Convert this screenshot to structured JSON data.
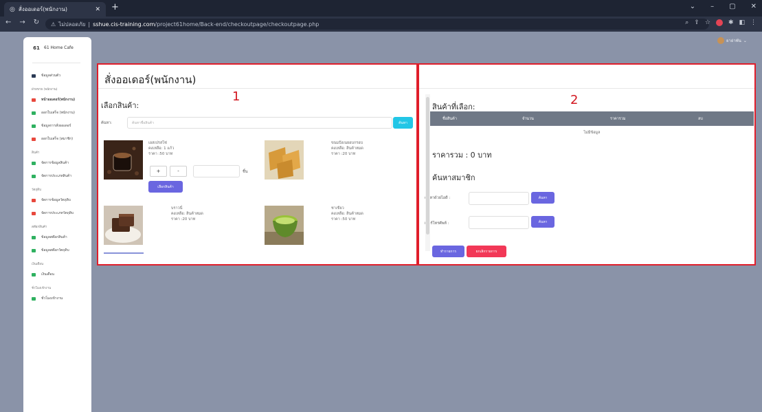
{
  "browser": {
    "tab_title": "สั่งออเดอร์(พนักงาน)",
    "new_tab": "+",
    "security_label": "ไม่ปลอดภัย",
    "url_domain": "sshue.cis-training.com",
    "url_path": "/project61home/Back-end/checkoutpage/checkoutpage.php"
  },
  "sidebar": {
    "brand_logo": "61",
    "brand_name": "61 Home Cafe",
    "items": [
      {
        "type": "item",
        "label": "ข้อมูลส่วนตัว",
        "color": "#2b3a55"
      },
      {
        "type": "head",
        "label": "ฝ่ายขาย (พนักงาน)"
      },
      {
        "type": "item",
        "label": "หน้าออเดอร์(พนักงาน)",
        "color": "#e8483d",
        "bold": true
      },
      {
        "type": "item",
        "label": "ออกใบเสร็จ (พนักงาน)",
        "color": "#2fb160"
      },
      {
        "type": "item",
        "label": "ข้อมูลการสั่งออเดอร์",
        "color": "#2fb160"
      },
      {
        "type": "item",
        "label": "ออกใบเสร็จ (สมาชิก)",
        "color": "#e8483d"
      },
      {
        "type": "head",
        "label": "สินค้า"
      },
      {
        "type": "item",
        "label": "จัดการข้อมูลสินค้า",
        "color": "#2fb160"
      },
      {
        "type": "item",
        "label": "จัดการประเภทสินค้า",
        "color": "#2fb160"
      },
      {
        "type": "head",
        "label": "วัตถุดิบ"
      },
      {
        "type": "item",
        "label": "จัดการข้อมูลวัตถุดิบ",
        "color": "#e8483d"
      },
      {
        "type": "item",
        "label": "จัดการประเภทวัตถุดิบ",
        "color": "#e8483d"
      },
      {
        "type": "head",
        "label": "สต๊อกสินค้า"
      },
      {
        "type": "item",
        "label": "ข้อมูลสต๊อกสินค้า",
        "color": "#2fb160"
      },
      {
        "type": "item",
        "label": "ข้อมูลสต๊อกวัตถุดิบ",
        "color": "#2fb160"
      },
      {
        "type": "head",
        "label": "เงินเดือน"
      },
      {
        "type": "item",
        "label": "เงินเดือน",
        "color": "#2fb160"
      },
      {
        "type": "head",
        "label": "ชั่วโมงเข้างาน"
      },
      {
        "type": "item",
        "label": "ชั่วโมงเข้างาน",
        "color": "#2fb160"
      }
    ]
  },
  "topbar": {
    "user": "ยาย่าพัน"
  },
  "panel1": {
    "annotation": "1",
    "title": "สั่งออเดอร์(พนักงาน)",
    "section": "เลือกสินค้า:",
    "search_label": "ค้นหา:",
    "search_placeholder": "ค้นหาชื่อสินค้า",
    "search_button": "ค้นหา",
    "products": [
      {
        "name": "เอสเปรสโซ่",
        "stock": "คงเหลือ: 1 แก้ว",
        "price": "ราคา :50 บาท",
        "img": "coffee"
      },
      {
        "name": "ขนมปังเนยอบกรอบ",
        "stock": "คงเหลือ: สินค้าหมด",
        "price": "ราคา :20 บาท",
        "img": "toast"
      },
      {
        "name": "บราวนี่",
        "stock": "คงเหลือ: สินค้าหมด",
        "price": "ราคา :20 บาท",
        "img": "brownie"
      },
      {
        "name": "ชาเขียว",
        "stock": "คงเหลือ: สินค้าหมด",
        "price": "ราคา :50 บาท",
        "img": "greentea"
      }
    ],
    "plus": "+",
    "minus": "-",
    "unit": "ชิ้น",
    "select_button": "เลือกสินค้า"
  },
  "panel2": {
    "annotation": "2",
    "section": "สินค้าที่เลือก:",
    "table_headers": [
      "ชื่อสินค้า",
      "จำนวน",
      "ราคารวม",
      "ลบ"
    ],
    "no_data": "ไม่มีข้อมูล",
    "total": "ราคารวม : 0 บาท",
    "member_section": "ค้นหาสมาชิก",
    "search_id_label": "ค้นหาด้วยไอดี :",
    "search_phone_label": "เบอร์โทรศัพท์ :",
    "search_button": "ค้นหา",
    "submit_button": "ทำรายการ",
    "cancel_button": "ยกเลิกรายการ"
  },
  "colors": {
    "highlight": "#e01d2a",
    "cyan": "#22c6e6",
    "purple": "#6a66e0",
    "danger": "#f23857",
    "page_bg": "#8a93a8"
  }
}
